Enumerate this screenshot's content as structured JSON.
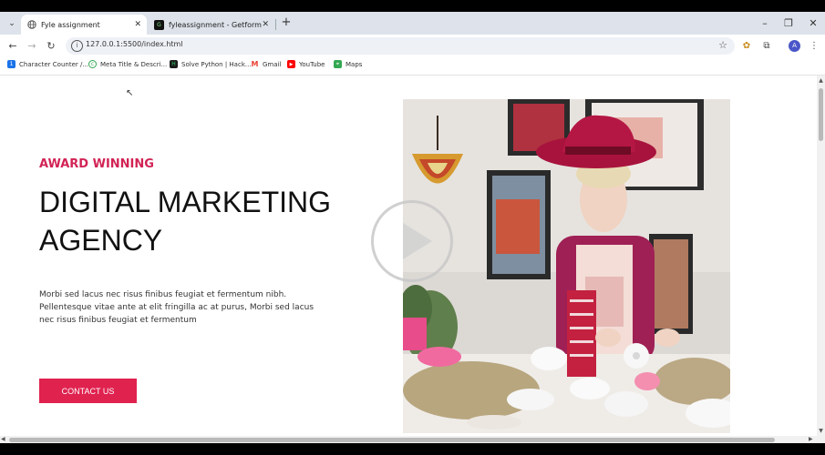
{
  "browser": {
    "tabs": [
      {
        "title": "Fyle assignment",
        "favicon": "globe-icon",
        "active": true
      },
      {
        "title": "fyleassignment - Getform.io",
        "favicon": "getform-icon",
        "active": false
      }
    ],
    "url": "127.0.0.1:5500/index.html",
    "profile_initial": "A"
  },
  "bookmarks": [
    {
      "label": "Character Counter /...",
      "icon": "character-counter-icon",
      "color": "#1a73e8"
    },
    {
      "label": "Meta Title & Descri...",
      "icon": "meta-title-icon",
      "color": "#34a853"
    },
    {
      "label": "Solve Python | Hack...",
      "icon": "hackerrank-icon",
      "color": "#1b1b1b"
    },
    {
      "label": "Gmail",
      "icon": "gmail-icon",
      "color": "#ea4335"
    },
    {
      "label": "YouTube",
      "icon": "youtube-icon",
      "color": "#ff0000"
    },
    {
      "label": "Maps",
      "icon": "maps-icon",
      "color": "#34a853"
    }
  ],
  "hero": {
    "eyebrow": "AWARD WINNING",
    "headline_line1": "DIGITAL MARKETING",
    "headline_line2": "AGENCY",
    "body": "Morbi sed lacus nec risus finibus feugiat et fermentum nibh. Pellentesque vitae ante at elit fringilla ac at purus, Morbi sed lacus nec risus finibus feugiat et fermentum",
    "cta_label": "CONTACT US"
  },
  "colors": {
    "accent": "#e0224f",
    "eyebrow": "#d22355",
    "tabstrip": "#dee3eb"
  }
}
